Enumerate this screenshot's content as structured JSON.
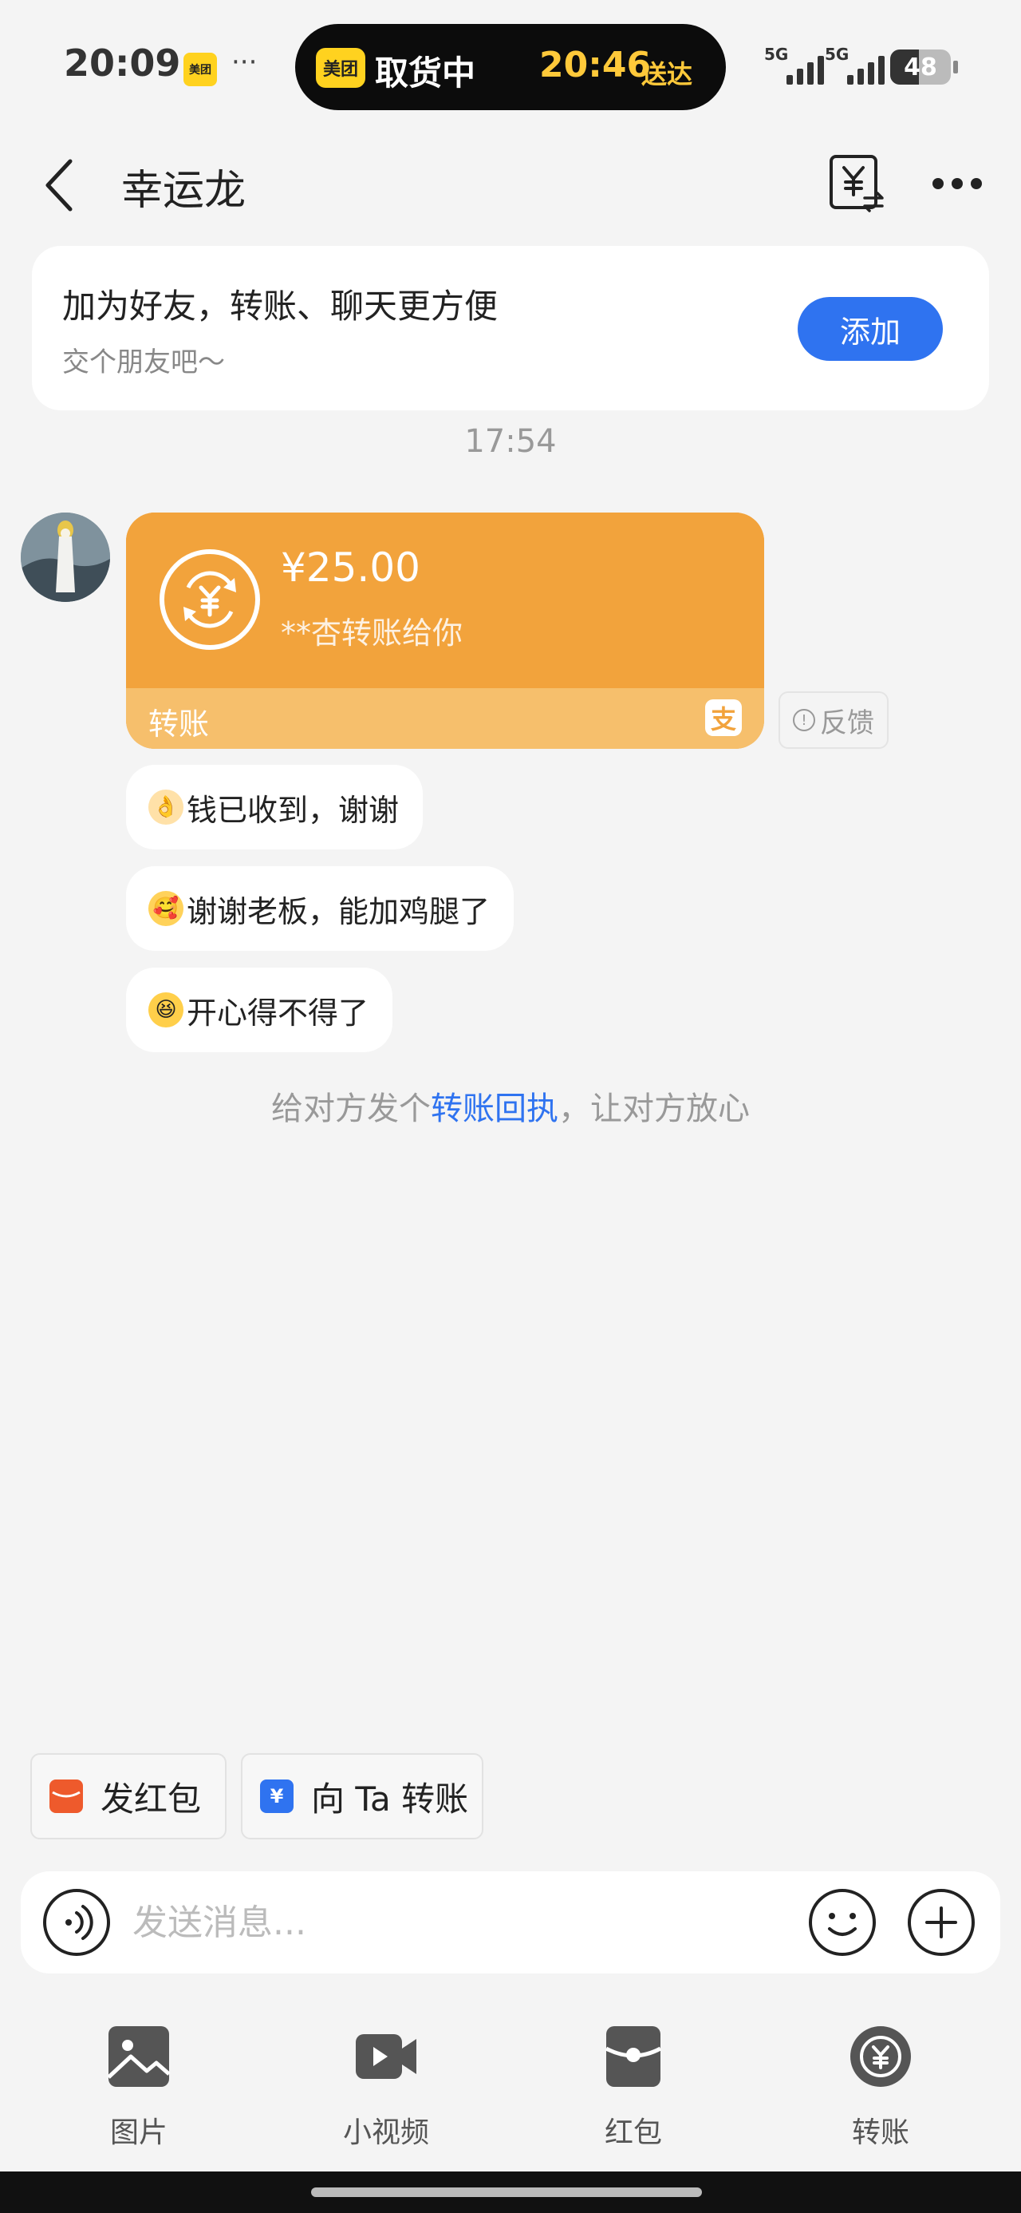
{
  "status_bar": {
    "time": "20:09",
    "meituan_badge": "美团",
    "more": "···",
    "island_logo": "美团",
    "island_status": "取货中",
    "island_eta": "20:46",
    "island_eta_label": "送达",
    "network_1": "5G",
    "network_2": "5G",
    "battery": "48",
    "battery_level": 0.48
  },
  "header": {
    "title": "幸运龙"
  },
  "friend_card": {
    "title": "加为好友，转账、聊天更方便",
    "subtitle": "交个朋友吧～",
    "add_label": "添加"
  },
  "chat": {
    "time": "17:54",
    "transfer": {
      "amount": "¥25.00",
      "note": "**杏转账给你",
      "type_label": "转账",
      "feedback_label": "反馈"
    },
    "messages": [
      {
        "emoji": "👌",
        "text": "钱已收到，谢谢"
      },
      {
        "emoji": "🥰",
        "text": "谢谢老板，能加鸡腿了"
      },
      {
        "emoji": "😆",
        "text": "开心得不得了"
      }
    ],
    "hint_prefix": "给对方发个",
    "hint_link": "转账回执",
    "hint_suffix": "，让对方放心"
  },
  "quick_actions": {
    "red_packet": "发红包",
    "transfer": "向 Ta 转账"
  },
  "input": {
    "placeholder": "发送消息..."
  },
  "toolbar": [
    {
      "icon": "image-icon",
      "label": "图片"
    },
    {
      "icon": "video-icon",
      "label": "小视频"
    },
    {
      "icon": "red-packet-icon",
      "label": "红包"
    },
    {
      "icon": "transfer-icon",
      "label": "转账"
    }
  ],
  "colors": {
    "accent_blue": "#2f73f0",
    "transfer_orange": "#f2a33c",
    "background": "#f4f4f4"
  }
}
